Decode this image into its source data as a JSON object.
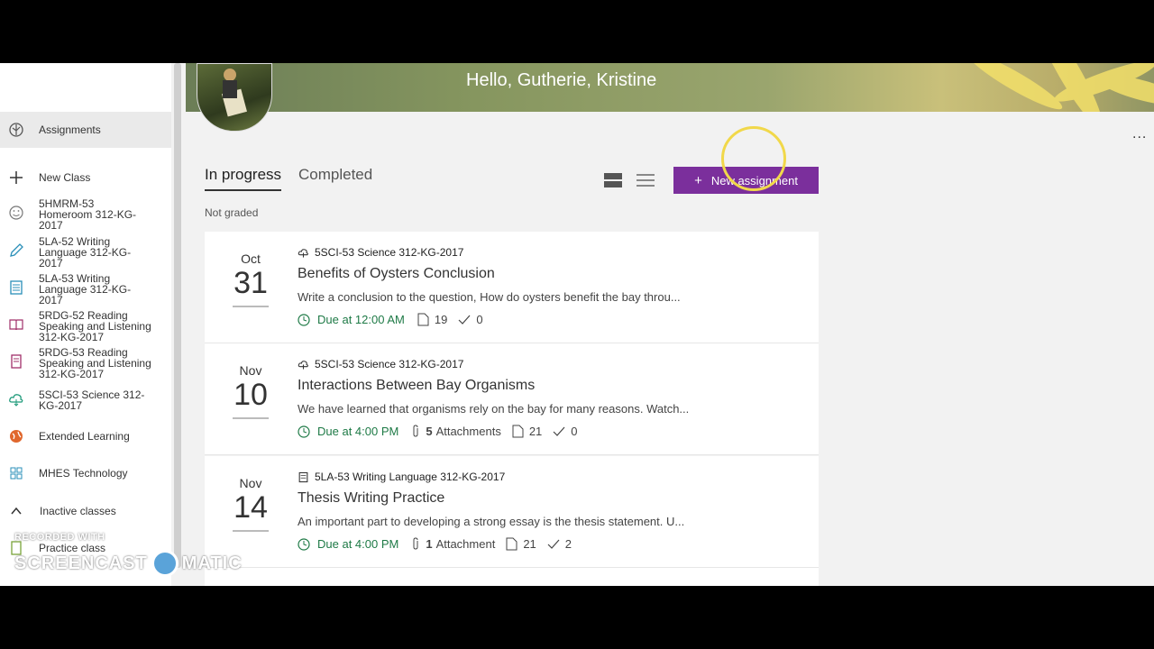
{
  "header": {
    "greeting": "Hello, Gutherie, Kristine",
    "more_label": "..."
  },
  "sidebar": {
    "items": [
      {
        "label": "Assignments",
        "icon": "assignments-icon"
      },
      {
        "label": "New Class",
        "icon": "plus-icon"
      },
      {
        "label": "5HMRM-53 Homeroom 312-KG-2017",
        "icon": "smiley-icon"
      },
      {
        "label": "5LA-52 Writing Language 312-KG-2017",
        "icon": "pencil-icon"
      },
      {
        "label": "5LA-53 Writing Language 312-KG-2017",
        "icon": "calculator-icon"
      },
      {
        "label": "5RDG-52 Reading Speaking and Listening 312-KG-2017",
        "icon": "book-icon"
      },
      {
        "label": "5RDG-53 Reading Speaking and Listening 312-KG-2017",
        "icon": "notebook-icon"
      },
      {
        "label": "5SCI-53 Science 312-KG-2017",
        "icon": "cloud-icon"
      },
      {
        "label": "Extended Learning",
        "icon": "globe-icon"
      },
      {
        "label": "MHES Technology",
        "icon": "grid-icon"
      },
      {
        "label": "Inactive classes",
        "icon": "chevron-up-icon"
      },
      {
        "label": "Practice class",
        "icon": "notebook-icon"
      }
    ]
  },
  "tabs": [
    {
      "label": "In progress",
      "active": true
    },
    {
      "label": "Completed",
      "active": false
    }
  ],
  "toolbar": {
    "new_assignment_label": "New assignment",
    "new_assignment_plus": "+"
  },
  "section_label": "Not graded",
  "assignments": [
    {
      "month": "Oct",
      "day": "31",
      "class_name": "5SCI-53 Science 312-KG-2017",
      "title": "Benefits of Oysters Conclusion",
      "description": "Write a conclusion to the question, How do oysters benefit the bay throu...",
      "due": "Due at 12:00 AM",
      "attachments": "",
      "submissions": "19",
      "graded": "0"
    },
    {
      "month": "Nov",
      "day": "10",
      "class_name": "5SCI-53 Science 312-KG-2017",
      "title": "Interactions Between Bay Organisms",
      "description": "We have learned that organisms rely on the bay for many reasons. Watch...",
      "due": "Due at 4:00 PM",
      "attachments_count": "5",
      "attachments_label": "Attachments",
      "submissions": "21",
      "graded": "0"
    },
    {
      "month": "Nov",
      "day": "14",
      "class_name": "5LA-53 Writing Language 312-KG-2017",
      "title": "Thesis Writing Practice",
      "description": "An important part to developing a strong essay is the thesis statement. U...",
      "due": "Due at 4:00 PM",
      "attachments_count": "1",
      "attachments_label": "Attachment",
      "submissions": "21",
      "graded": "2"
    }
  ],
  "watermark": {
    "line1": "RECORDED WITH",
    "line2a": "SCREENCAST",
    "line2b": "MATIC"
  },
  "colors": {
    "accent": "#7b2f9c",
    "due_green": "#1e7a46"
  }
}
